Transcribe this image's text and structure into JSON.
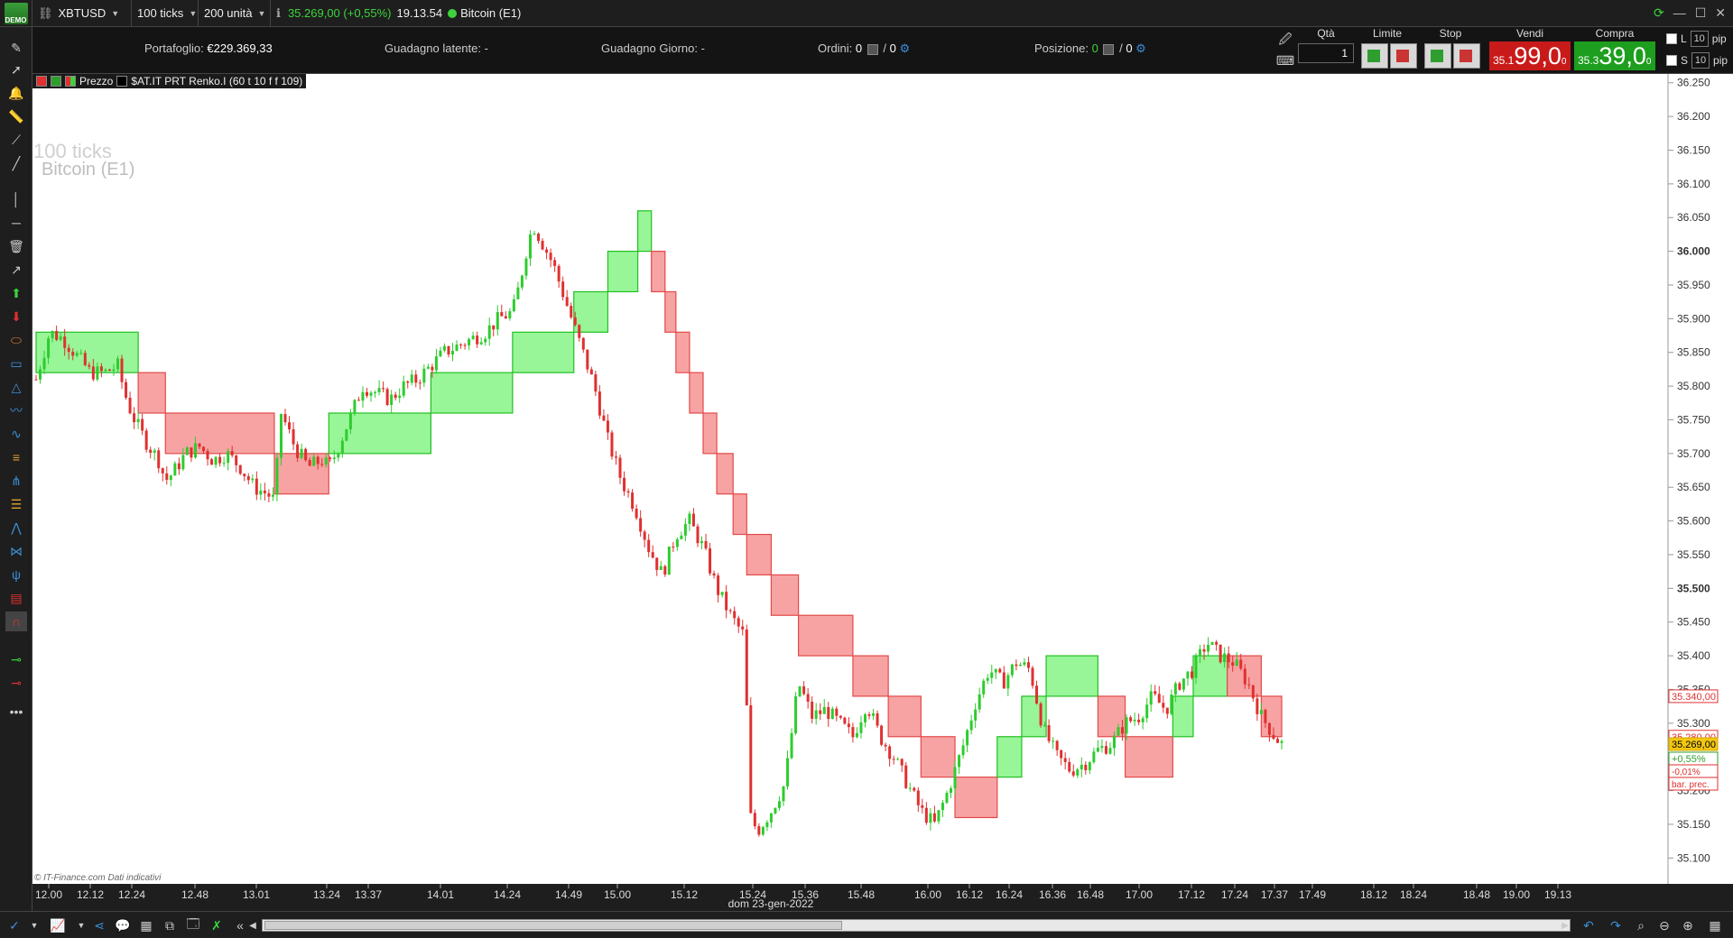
{
  "topbar": {
    "logo_label": "DEMO",
    "symbol": "XBTUSD",
    "interval": "100 ticks",
    "units": "200 unità",
    "last_price": "35.269,00 (+0,55%)",
    "time": "19.13.54",
    "instrument": "Bitcoin (E1)"
  },
  "info": {
    "portafoglio_label": "Portafoglio:",
    "portafoglio_value": "€229.369,33",
    "guadagno_latente": "Guadagno latente: -",
    "guadagno_giorno": "Guadagno Giorno: -",
    "ordini_label": "Ordini:",
    "ordini_value": "0",
    "ordini_value2": "0",
    "posizione_label": "Posizione:",
    "posizione_value": "0",
    "posizione_value2": "0"
  },
  "order_panel": {
    "qta_label": "Qtà",
    "qta_value": "1",
    "limite_label": "Limite",
    "stop_label": "Stop",
    "vendi_label": "Vendi",
    "compra_label": "Compra",
    "sell_small": "35.1",
    "sell_big": "99,0",
    "sell_sup": "0",
    "buy_small": "35.3",
    "buy_big": "39,0",
    "buy_sup": "0",
    "l_label": "L",
    "s_label": "S",
    "pip_value": "10",
    "pip_label": "pip"
  },
  "legend": {
    "prezzo": "Prezzo",
    "indicator": "$AT.IT PRT Renko.I (60 t 10 f f 109)"
  },
  "watermark": {
    "line1": "100 ticks",
    "line2": "Bitcoin (E1)"
  },
  "copyright": "© IT-Finance.com  Dati indicativi",
  "axis_date": "dom 23-gen-2022",
  "colors": {
    "up_candle": "#2ecc2e",
    "down_candle": "#e03030",
    "renko_up_fill": "#98f598",
    "renko_down_fill": "#f7a3a3",
    "renko_up_edge": "#22c022",
    "renko_down_edge": "#e34a4a",
    "sell_red": "#c91a1a",
    "buy_green": "#1e9e1e"
  },
  "chart_data": {
    "type": "candlestick",
    "ylim": [
      35075,
      36250
    ],
    "y_ticks": [
      "36.250",
      "36.200",
      "36.150",
      "36.100",
      "36.050",
      "36.000",
      "35.950",
      "35.900",
      "35.850",
      "35.800",
      "35.750",
      "35.700",
      "35.650",
      "35.600",
      "35.550",
      "35.500",
      "35.450",
      "35.400",
      "35.350",
      "35.300",
      "35.250",
      "35.200",
      "35.150",
      "35.100"
    ],
    "y_ticks_bold": [
      "36.000",
      "35.500"
    ],
    "x_ticks": [
      "12.00",
      "12.12",
      "12.24",
      "12.48",
      "13.01",
      "13.24",
      "13.37",
      "14.01",
      "14.24",
      "14.49",
      "15.00",
      "15.12",
      "15.24",
      "15.36",
      "15.48",
      "16.00",
      "16.12",
      "16.24",
      "16.36",
      "16.48",
      "17.00",
      "17.12",
      "17.24",
      "17.37",
      "17.49",
      "18.12",
      "18.24",
      "18.48",
      "19.00",
      "19.13"
    ],
    "price_path": [
      [
        0,
        35810
      ],
      [
        10,
        35880
      ],
      [
        20,
        35870
      ],
      [
        30,
        35845
      ],
      [
        40,
        35820
      ],
      [
        50,
        35820
      ],
      [
        60,
        35830
      ],
      [
        65,
        35790
      ],
      [
        70,
        35760
      ],
      [
        80,
        35720
      ],
      [
        90,
        35690
      ],
      [
        95,
        35660
      ],
      [
        100,
        35670
      ],
      [
        110,
        35700
      ],
      [
        120,
        35710
      ],
      [
        130,
        35690
      ],
      [
        140,
        35700
      ],
      [
        150,
        35680
      ],
      [
        160,
        35650
      ],
      [
        170,
        35640
      ],
      [
        175,
        35630
      ],
      [
        180,
        35760
      ],
      [
        190,
        35710
      ],
      [
        200,
        35680
      ],
      [
        210,
        35690
      ],
      [
        215,
        35680
      ],
      [
        220,
        35700
      ],
      [
        230,
        35750
      ],
      [
        240,
        35800
      ],
      [
        250,
        35790
      ],
      [
        260,
        35780
      ],
      [
        270,
        35800
      ],
      [
        280,
        35810
      ],
      [
        290,
        35830
      ],
      [
        300,
        35850
      ],
      [
        310,
        35860
      ],
      [
        320,
        35870
      ],
      [
        330,
        35880
      ],
      [
        340,
        35900
      ],
      [
        350,
        35910
      ],
      [
        355,
        35950
      ],
      [
        360,
        36000
      ],
      [
        365,
        36040
      ],
      [
        370,
        36020
      ],
      [
        380,
        35980
      ],
      [
        390,
        35920
      ],
      [
        400,
        35860
      ],
      [
        410,
        35800
      ],
      [
        420,
        35720
      ],
      [
        430,
        35660
      ],
      [
        440,
        35620
      ],
      [
        450,
        35560
      ],
      [
        460,
        35520
      ],
      [
        470,
        35580
      ],
      [
        480,
        35600
      ],
      [
        490,
        35560
      ],
      [
        500,
        35500
      ],
      [
        510,
        35460
      ],
      [
        520,
        35430
      ],
      [
        525,
        35160
      ],
      [
        530,
        35140
      ],
      [
        540,
        35170
      ],
      [
        550,
        35210
      ],
      [
        560,
        35360
      ],
      [
        570,
        35310
      ],
      [
        580,
        35320
      ],
      [
        590,
        35300
      ],
      [
        600,
        35280
      ],
      [
        610,
        35330
      ],
      [
        620,
        35280
      ],
      [
        630,
        35250
      ],
      [
        640,
        35210
      ],
      [
        650,
        35170
      ],
      [
        660,
        35150
      ],
      [
        670,
        35200
      ],
      [
        680,
        35260
      ],
      [
        690,
        35330
      ],
      [
        700,
        35380
      ],
      [
        710,
        35360
      ],
      [
        720,
        35390
      ],
      [
        730,
        35380
      ],
      [
        740,
        35290
      ],
      [
        750,
        35250
      ],
      [
        760,
        35230
      ],
      [
        770,
        35240
      ],
      [
        780,
        35260
      ],
      [
        790,
        35270
      ],
      [
        800,
        35300
      ],
      [
        810,
        35310
      ],
      [
        820,
        35340
      ],
      [
        830,
        35320
      ],
      [
        840,
        35360
      ],
      [
        850,
        35380
      ],
      [
        860,
        35420
      ],
      [
        870,
        35400
      ],
      [
        880,
        35390
      ],
      [
        890,
        35360
      ],
      [
        900,
        35310
      ],
      [
        910,
        35280
      ],
      [
        915,
        35269
      ]
    ],
    "renko_boxes": [
      {
        "start": 0,
        "end": 75,
        "low": 35820,
        "high": 35880,
        "dir": "up"
      },
      {
        "start": 75,
        "end": 95,
        "low": 35760,
        "high": 35820,
        "dir": "down"
      },
      {
        "start": 95,
        "end": 175,
        "low": 35700,
        "high": 35760,
        "dir": "down"
      },
      {
        "start": 175,
        "end": 215,
        "low": 35640,
        "high": 35700,
        "dir": "down"
      },
      {
        "start": 215,
        "end": 290,
        "low": 35700,
        "high": 35760,
        "dir": "up"
      },
      {
        "start": 290,
        "end": 350,
        "low": 35760,
        "high": 35820,
        "dir": "up"
      },
      {
        "start": 350,
        "end": 395,
        "low": 35820,
        "high": 35880,
        "dir": "up"
      },
      {
        "start": 395,
        "end": 420,
        "low": 35880,
        "high": 35940,
        "dir": "up"
      },
      {
        "start": 420,
        "end": 442,
        "low": 35940,
        "high": 36000,
        "dir": "up"
      },
      {
        "start": 442,
        "end": 452,
        "low": 36000,
        "high": 36060,
        "dir": "up"
      },
      {
        "start": 452,
        "end": 462,
        "low": 35940,
        "high": 36000,
        "dir": "down"
      },
      {
        "start": 462,
        "end": 470,
        "low": 35880,
        "high": 35940,
        "dir": "down"
      },
      {
        "start": 470,
        "end": 480,
        "low": 35820,
        "high": 35880,
        "dir": "down"
      },
      {
        "start": 480,
        "end": 490,
        "low": 35760,
        "high": 35820,
        "dir": "down"
      },
      {
        "start": 490,
        "end": 500,
        "low": 35700,
        "high": 35760,
        "dir": "down"
      },
      {
        "start": 500,
        "end": 512,
        "low": 35640,
        "high": 35700,
        "dir": "down"
      },
      {
        "start": 512,
        "end": 522,
        "low": 35580,
        "high": 35640,
        "dir": "down"
      },
      {
        "start": 522,
        "end": 540,
        "low": 35520,
        "high": 35580,
        "dir": "down"
      },
      {
        "start": 540,
        "end": 560,
        "low": 35460,
        "high": 35520,
        "dir": "down"
      },
      {
        "start": 560,
        "end": 600,
        "low": 35400,
        "high": 35460,
        "dir": "down"
      },
      {
        "start": 600,
        "end": 626,
        "low": 35340,
        "high": 35400,
        "dir": "down"
      },
      {
        "start": 626,
        "end": 650,
        "low": 35280,
        "high": 35340,
        "dir": "down"
      },
      {
        "start": 650,
        "end": 675,
        "low": 35220,
        "high": 35280,
        "dir": "down"
      },
      {
        "start": 675,
        "end": 706,
        "low": 35160,
        "high": 35220,
        "dir": "down"
      },
      {
        "start": 706,
        "end": 724,
        "low": 35220,
        "high": 35280,
        "dir": "up"
      },
      {
        "start": 724,
        "end": 742,
        "low": 35280,
        "high": 35340,
        "dir": "up"
      },
      {
        "start": 742,
        "end": 780,
        "low": 35340,
        "high": 35400,
        "dir": "up"
      },
      {
        "start": 780,
        "end": 800,
        "low": 35280,
        "high": 35340,
        "dir": "down"
      },
      {
        "start": 800,
        "end": 835,
        "low": 35220,
        "high": 35280,
        "dir": "down"
      },
      {
        "start": 835,
        "end": 850,
        "low": 35280,
        "high": 35340,
        "dir": "up"
      },
      {
        "start": 850,
        "end": 875,
        "low": 35340,
        "high": 35400,
        "dir": "up"
      },
      {
        "start": 875,
        "end": 900,
        "low": 35340,
        "high": 35400,
        "dir": "down"
      },
      {
        "start": 900,
        "end": 915,
        "low": 35280,
        "high": 35340,
        "dir": "down"
      }
    ],
    "price_tags": [
      {
        "label": "35.340,00",
        "value": 35340,
        "style": "red"
      },
      {
        "label": "35.280,00",
        "value": 35280,
        "style": "red"
      },
      {
        "label": "35.269,00",
        "value": 35269,
        "style": "yellow"
      }
    ],
    "change_tags": [
      {
        "label": "+0,55%",
        "style": "green"
      },
      {
        "label": "-0,01%",
        "style": "red"
      },
      {
        "label": "bar. prec.",
        "style": "red"
      }
    ]
  }
}
